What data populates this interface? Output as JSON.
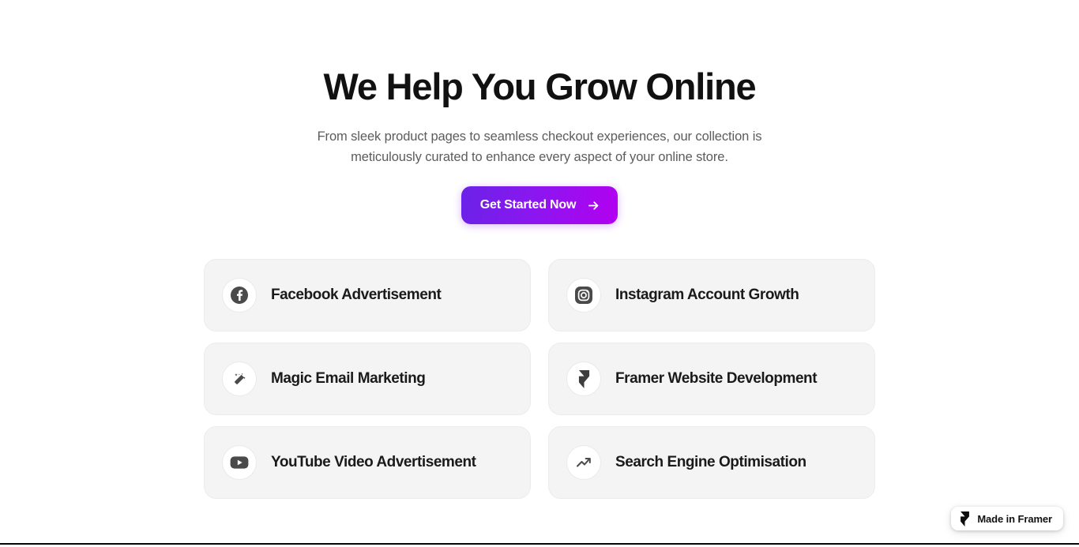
{
  "hero": {
    "title": "We Help You Grow Online",
    "subtitle": "From sleek product pages to seamless checkout experiences, our collection is meticulously curated to enhance every aspect of your online store.",
    "cta_label": "Get Started Now",
    "cta_icon": "arrow-right-icon"
  },
  "services": [
    {
      "label": "Facebook Advertisement",
      "icon": "facebook-icon"
    },
    {
      "label": "Instagram Account Growth",
      "icon": "instagram-icon"
    },
    {
      "label": "Magic Email Marketing",
      "icon": "magic-wand-icon"
    },
    {
      "label": "Framer Website Development",
      "icon": "framer-icon"
    },
    {
      "label": "YouTube Video Advertisement",
      "icon": "youtube-icon"
    },
    {
      "label": "Search Engine Optimisation",
      "icon": "trending-up-icon"
    }
  ],
  "badge": {
    "label": "Made in Framer",
    "icon": "framer-icon"
  },
  "colors": {
    "cta_gradient_start": "#6a22e8",
    "cta_gradient_end": "#b300f0",
    "card_background": "#f4f4f4",
    "card_border": "#ececec",
    "heading_text": "#111111",
    "body_text": "#5c5c5c",
    "icon_fill": "#4a4a4a"
  }
}
